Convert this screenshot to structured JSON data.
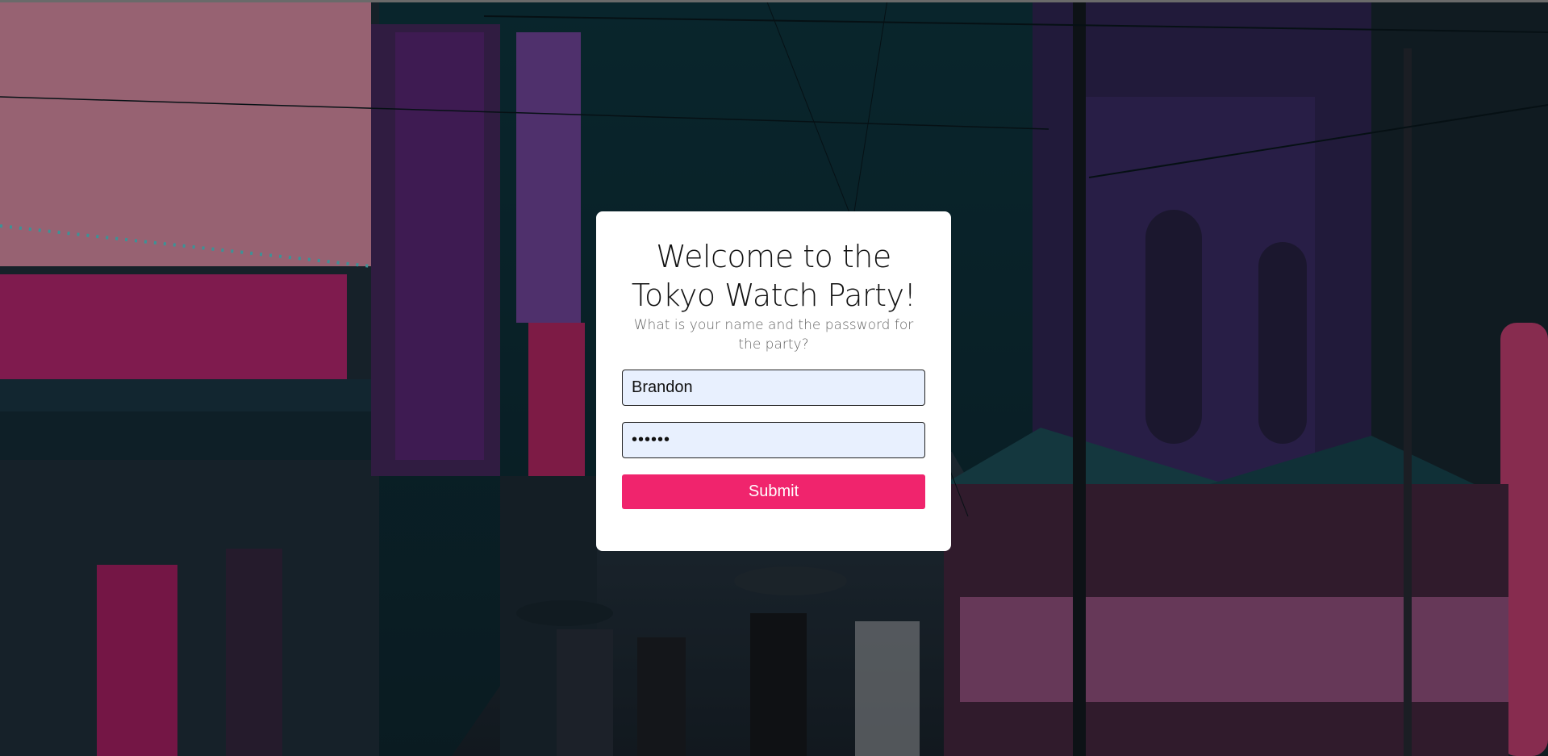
{
  "login": {
    "title_line1": "Welcome to the",
    "title_line2": "Tokyo Watch Party!",
    "subtitle": "What is your name and the password for the party?",
    "name_value": "Brandon",
    "password_value": "••••••",
    "submit_label": "Submit"
  },
  "colors": {
    "submit_bg": "#f0246d",
    "input_bg": "#e8f0fe",
    "card_bg": "#ffffff"
  }
}
